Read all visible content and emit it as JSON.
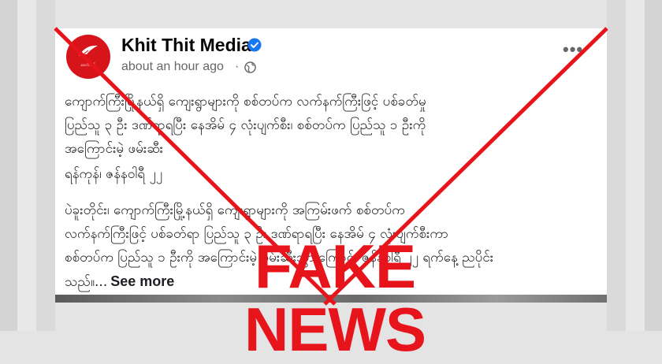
{
  "post": {
    "author": "Khit Thit Media",
    "timestamp": "about an hour ago",
    "separator": "·",
    "more_label": "•••",
    "avatar_text": "ခေတ်သစ်",
    "headline_lines": [
      "ကျောက်ကြီးမြို့နယ်ရှိ ကျေးရွာများကို စစ်တပ်က လက်နက်ကြီးဖြင့် ပစ်ခတ်မှု",
      "ပြည်သူ ၃ ဦး ဒဏ်ရာရပြီး နေအိမ် ၄ လုံးပျက်စီး၊ စစ်တပ်က ပြည်သူ ၁ ဦးကို",
      "အကြောင်းမဲ့ ဖမ်းဆီး"
    ],
    "dateline": "ရန်ကုန်၊ ဇန်နဝါရီ ၂၂",
    "body_lines": [
      "ပဲခူးတိုင်း၊ ကျောက်ကြီးမြို့နယ်ရှိ ကျေးရွာများကို အကြမ်းဖက် စစ်တပ်က",
      "လက်နက်ကြီးဖြင့် ပစ်ခတ်ရာ ပြည်သူ ၃ ဦး ဒဏ်ရာရပြီး နေအိမ် ၄ လုံးပျက်စီးကာ",
      "စစ်တပ်က ပြည်သူ ၁ ဦးကို အကြောင်းမဲ့ ဖမ်းဆီးသွားကြောင်း ဇန်နဝါရီ ၂၂ ရက်နေ့ ညပိုင်း"
    ],
    "body_last": "သည်။...",
    "see_more": "See more"
  },
  "overlay": {
    "stamp_text": "FAKE NEWS",
    "color": "#e8141c"
  },
  "colors": {
    "card": "#ffffff",
    "text": "#1c1e21",
    "meta": "#65676b",
    "verified": "#1877f2",
    "avatar": "#d7141a"
  }
}
